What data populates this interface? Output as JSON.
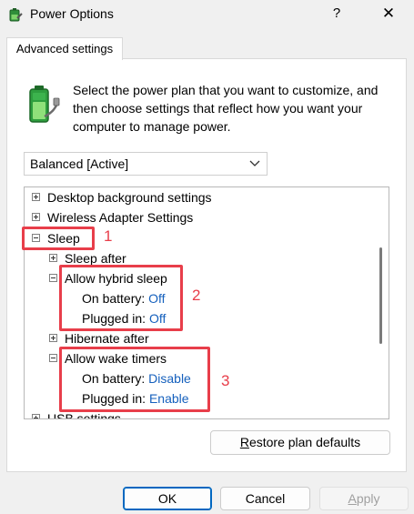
{
  "window": {
    "title": "Power Options",
    "help_glyph": "?",
    "close_glyph": "✕"
  },
  "tab": {
    "label": "Advanced settings"
  },
  "description": "Select the power plan that you want to customize, and then choose settings that reflect how you want your computer to manage power.",
  "plan_select": {
    "value": "Balanced [Active]"
  },
  "tree": {
    "desktop_background": "Desktop background settings",
    "wireless_adapter": "Wireless Adapter Settings",
    "sleep": "Sleep",
    "sleep_after": "Sleep after",
    "allow_hybrid_sleep": "Allow hybrid sleep",
    "hybrid_on_battery_label": "On battery:",
    "hybrid_on_battery_value": "Off",
    "hybrid_plugged_in_label": "Plugged in:",
    "hybrid_plugged_in_value": "Off",
    "hibernate_after": "Hibernate after",
    "allow_wake_timers": "Allow wake timers",
    "wake_on_battery_label": "On battery:",
    "wake_on_battery_value": "Disable",
    "wake_plugged_in_label": "Plugged in:",
    "wake_plugged_in_value": "Enable",
    "usb_settings": "USB settings"
  },
  "annotations": {
    "one": "1",
    "two": "2",
    "three": "3"
  },
  "buttons": {
    "restore_key": "R",
    "restore_rest": "estore plan defaults",
    "ok": "OK",
    "cancel": "Cancel",
    "apply_key": "A",
    "apply_rest": "pply"
  },
  "colors": {
    "accent": "#0067c0",
    "value_link": "#1560bd",
    "annotation_red": "#e83e4a"
  }
}
